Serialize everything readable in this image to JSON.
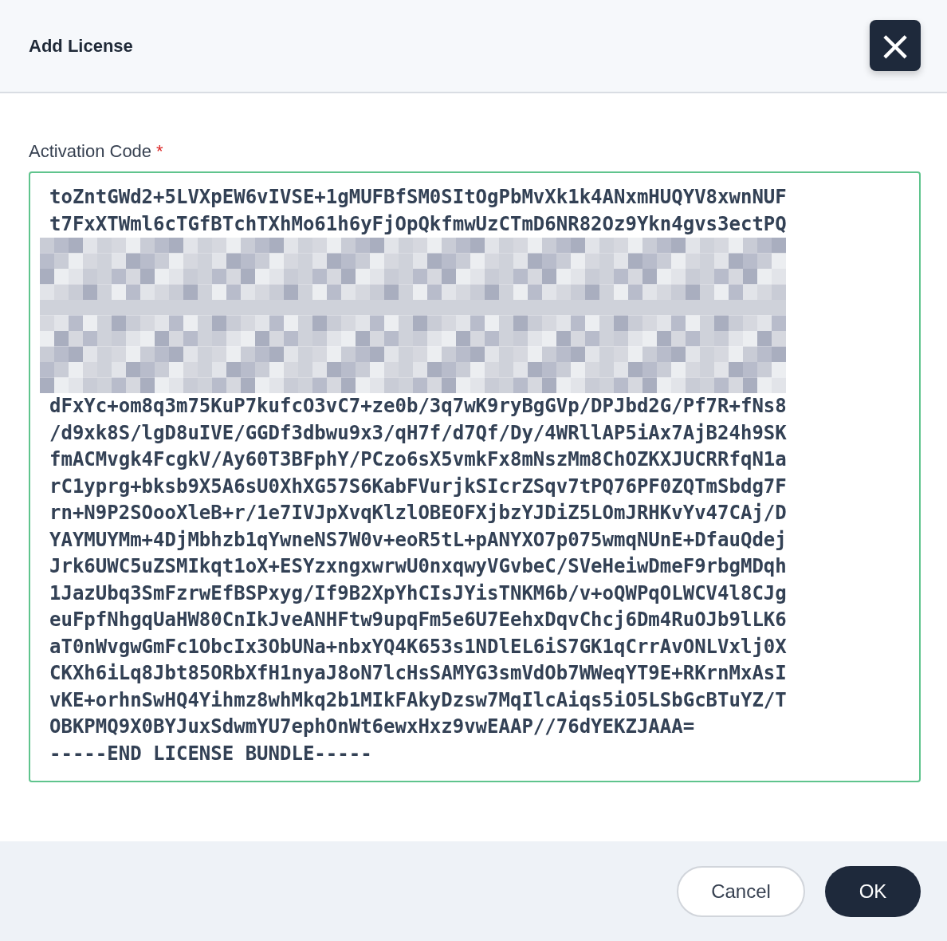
{
  "dialog": {
    "title": "Add License",
    "close_icon": "×"
  },
  "field": {
    "label": "Activation Code",
    "required_mark": "*",
    "code_lines": [
      {
        "kind": "text",
        "text": "toZntGWd2+5LVXpEW6vIVSE+1gMUFBfSM0SItOgPbMvXk1k4ANxmHUQYV8xwnNUF"
      },
      {
        "kind": "text",
        "text": "t7FxXTWml6cTGfBTchTXhMo61h6yFjOpQkfmwUzCTmD6NR82Oz9Ykn4gvs3ectPQ"
      },
      {
        "kind": "redacted"
      },
      {
        "kind": "text",
        "text": "dFxYc+om8q3m75KuP7kufcO3vC7+ze0b/3q7wK9ryBgGVp/DPJbd2G/Pf7R+fNs8"
      },
      {
        "kind": "text",
        "text": "/d9xk8S/lgD8uIVE/GGDf3dbwu9x3/qH7f/d7Qf/Dy/4WRllAP5iAx7AjB24h9SK"
      },
      {
        "kind": "text",
        "text": "fmACMvgk4FcgkV/Ay60T3BFphY/PCzo6sX5vmkFx8mNszMm8ChOZKXJUCRRfqN1a"
      },
      {
        "kind": "text",
        "text": "rC1yprg+bksb9X5A6sU0XhXG57S6KabFVurjkSIcrZSqv7tPQ76PF0ZQTmSbdg7F"
      },
      {
        "kind": "text",
        "text": "rn+N9P2SOooXleB+r/1e7IVJpXvqKlzlOBEOFXjbzYJDiZ5LOmJRHKvYv47CAj/D"
      },
      {
        "kind": "text",
        "text": "YAYMUYMm+4DjMbhzb1qYwneNS7W0v+eoR5tL+pANYXO7p075wmqNUnE+DfauQdej"
      },
      {
        "kind": "text",
        "text": "Jrk6UWC5uZSMIkqt1oX+ESYzxngxwrwU0nxqwyVGvbeC/SVeHeiwDmeF9rbgMDqh"
      },
      {
        "kind": "text",
        "text": "1JazUbq3SmFzrwEfBSPxyg/If9B2XpYhCIsJYisTNKM6b/v+oQWPqOLWCV4l8CJg"
      },
      {
        "kind": "text",
        "text": "euFpfNhgqUaHW80CnIkJveANHFtw9upqFm5e6U7EehxDqvChcj6Dm4RuOJb9lLK6"
      },
      {
        "kind": "text",
        "text": "aT0nWvgwGmFc1ObcIx3ObUNa+nbxYQ4K653s1NDlEL6iS7GK1qCrrAvONLVxlj0X"
      },
      {
        "kind": "text",
        "text": "CKXh6iLq8Jbt85ORbXfH1nyaJ8oN7lcHsSAMYG3smVdOb7WWeqYT9E+RKrnMxAsI"
      },
      {
        "kind": "text",
        "text": "vKE+orhnSwHQ4Yihmz8whMkq2b1MIkFAkyDzsw7MqIlcAiqs5iO5LSbGcBTuYZ/T"
      },
      {
        "kind": "text",
        "text": "OBKPMQ9X0BYJuxSdwmYU7ephOnWt6ewxHxz9vwEAAP//76dYEKZJAAA="
      },
      {
        "kind": "text",
        "text": "-----END LICENSE BUNDLE-----"
      }
    ]
  },
  "buttons": [
    {
      "label": "Cancel",
      "kind": "secondary"
    },
    {
      "label": "OK",
      "kind": "primary"
    }
  ]
}
